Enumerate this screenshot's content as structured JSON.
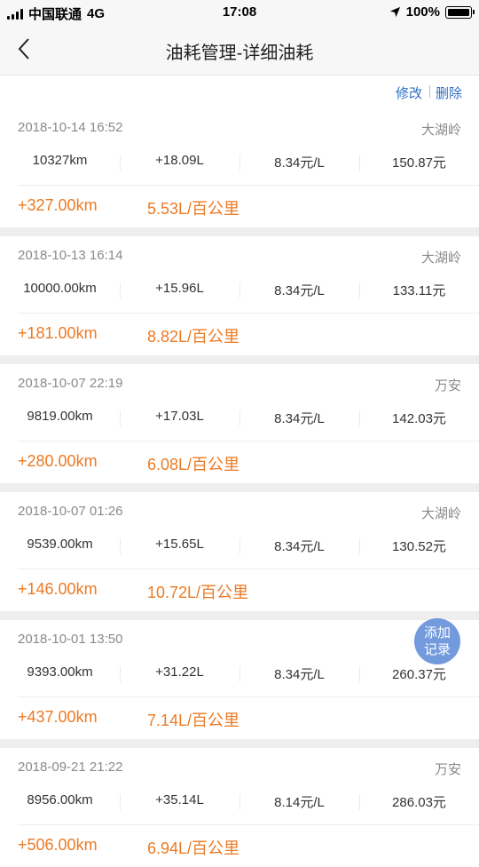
{
  "status_bar": {
    "carrier": "中国联通",
    "network": "4G",
    "time": "17:08",
    "battery": "100%"
  },
  "nav": {
    "title": "油耗管理-详细油耗"
  },
  "actions": {
    "edit": "修改",
    "delete": "删除"
  },
  "records": [
    {
      "datetime": "2018-10-14 16:52",
      "place": "大湖岭",
      "odometer": "10327km",
      "fuel": "+18.09L",
      "price": "8.34元/L",
      "amount": "150.87元",
      "distance": "+327.00km",
      "consumption": "5.53L/百公里"
    },
    {
      "datetime": "2018-10-13 16:14",
      "place": "大湖岭",
      "odometer": "10000.00km",
      "fuel": "+15.96L",
      "price": "8.34元/L",
      "amount": "133.11元",
      "distance": "+181.00km",
      "consumption": "8.82L/百公里"
    },
    {
      "datetime": "2018-10-07 22:19",
      "place": "万安",
      "odometer": "9819.00km",
      "fuel": "+17.03L",
      "price": "8.34元/L",
      "amount": "142.03元",
      "distance": "+280.00km",
      "consumption": "6.08L/百公里"
    },
    {
      "datetime": "2018-10-07 01:26",
      "place": "大湖岭",
      "odometer": "9539.00km",
      "fuel": "+15.65L",
      "price": "8.34元/L",
      "amount": "130.52元",
      "distance": "+146.00km",
      "consumption": "10.72L/百公里"
    },
    {
      "datetime": "2018-10-01 13:50",
      "place": "",
      "odometer": "9393.00km",
      "fuel": "+31.22L",
      "price": "8.34元/L",
      "amount": "260.37元",
      "distance": "+437.00km",
      "consumption": "7.14L/百公里"
    },
    {
      "datetime": "2018-09-21 21:22",
      "place": "万安",
      "odometer": "8956.00km",
      "fuel": "+35.14L",
      "price": "8.14元/L",
      "amount": "286.03元",
      "distance": "+506.00km",
      "consumption": "6.94L/百公里"
    }
  ],
  "fab": {
    "line1": "添加",
    "line2": "记录"
  },
  "colors": {
    "accent_orange": "#ec7a24",
    "link_blue": "#2f6fc9",
    "fab_blue": "#5484d6",
    "separator": "#eeeeee"
  }
}
